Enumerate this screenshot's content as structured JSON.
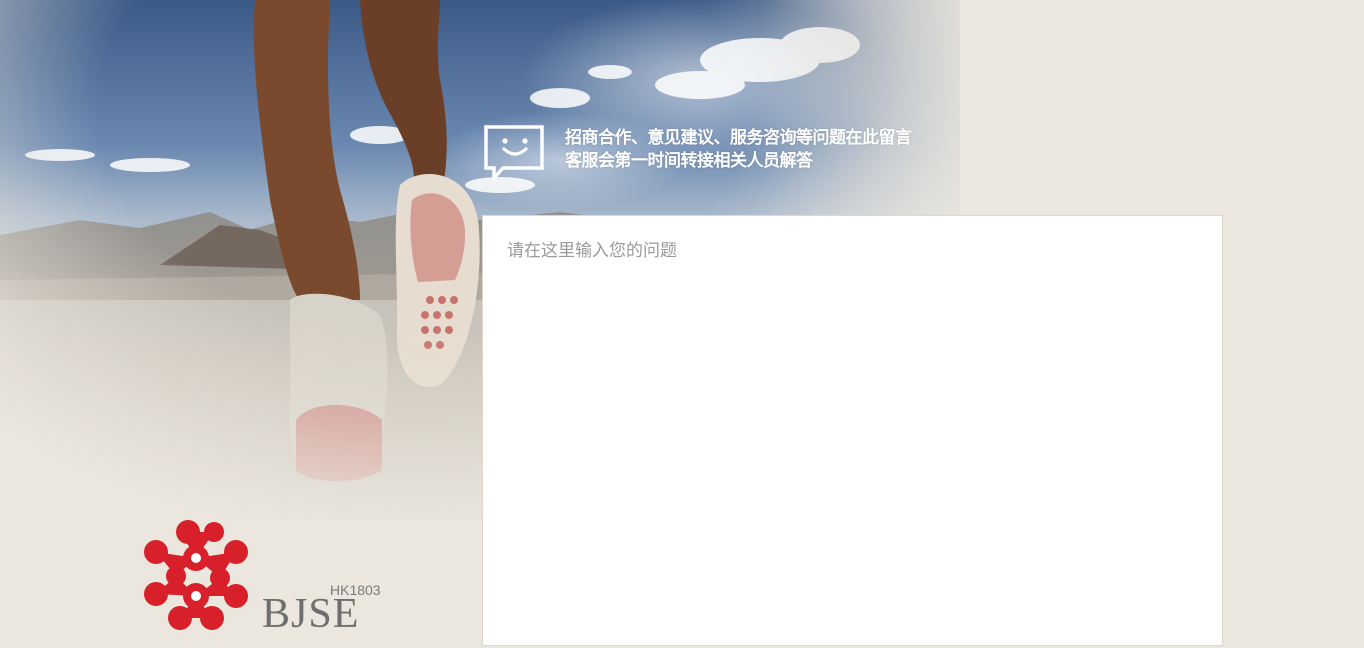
{
  "header": {
    "line1": "招商合作、意见建议、服务咨询等问题在此留言",
    "line2": "客服会第一时间转接相关人员解答",
    "icon": "smile-speech-bubble-icon"
  },
  "form": {
    "question_placeholder": "请在这里输入您的问题",
    "question_value": ""
  },
  "brand": {
    "stock_code": "HK1803",
    "name": "BJSE",
    "logo_icon": "red-dots-logo-icon",
    "accent_color": "#d7202a"
  },
  "colors": {
    "background": "#ebe7de",
    "sky": "#3c5a87"
  }
}
